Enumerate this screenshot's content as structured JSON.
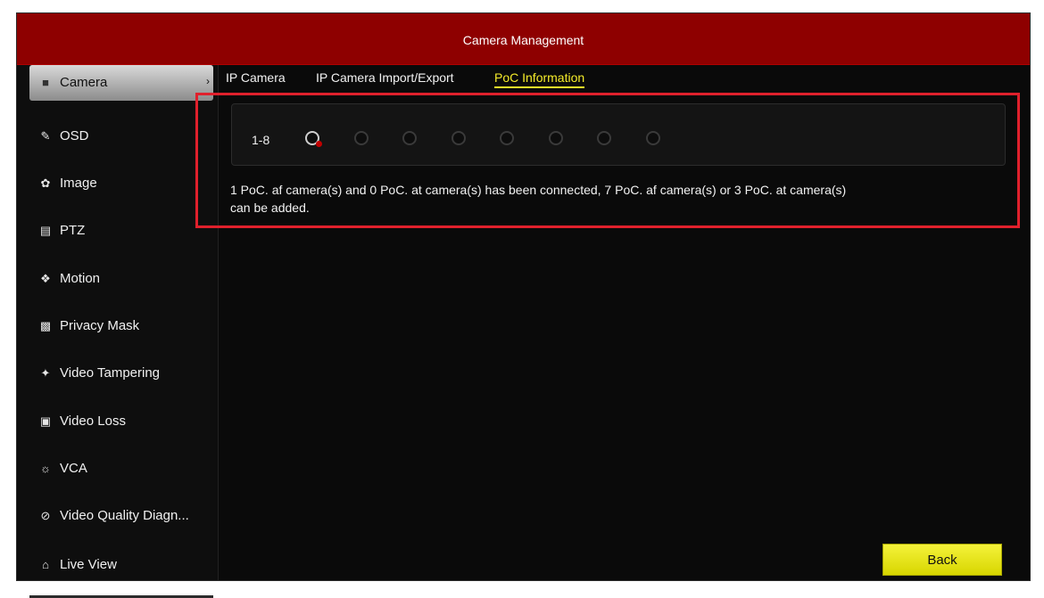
{
  "window": {
    "title": "Camera Management"
  },
  "sidebar": {
    "items": [
      {
        "label": "Camera",
        "icon": "camera-icon",
        "active": true
      },
      {
        "label": "OSD",
        "icon": "pen-icon"
      },
      {
        "label": "Image",
        "icon": "palette-icon"
      },
      {
        "label": "PTZ",
        "icon": "ptz-icon"
      },
      {
        "label": "Motion",
        "icon": "running-man-icon"
      },
      {
        "label": "Privacy Mask",
        "icon": "mask-icon"
      },
      {
        "label": "Video Tampering",
        "icon": "hand-icon"
      },
      {
        "label": "Video Loss",
        "icon": "question-box-icon"
      },
      {
        "label": "VCA",
        "icon": "vca-icon"
      },
      {
        "label": "Video Quality Diagn...",
        "icon": "diagnosis-icon"
      }
    ],
    "live_view": {
      "label": "Live View",
      "icon": "home-icon"
    }
  },
  "tabs": [
    {
      "label": "IP Camera"
    },
    {
      "label": "IP Camera Import/Export"
    },
    {
      "label": "PoC Information",
      "active": true
    }
  ],
  "poc": {
    "channel_range": "1-8",
    "ports": [
      {
        "status": "connected"
      },
      {
        "status": "empty"
      },
      {
        "status": "empty"
      },
      {
        "status": "empty"
      },
      {
        "status": "empty"
      },
      {
        "status": "empty"
      },
      {
        "status": "empty"
      },
      {
        "status": "empty"
      }
    ],
    "info_line1": "1 PoC. af camera(s) and 0 PoC. at camera(s) has been connected, 7 PoC. af camera(s) or 3 PoC. at camera(s)",
    "info_line2": "can be added."
  },
  "buttons": {
    "back": "Back"
  },
  "colors": {
    "titlebar": "#8e0000",
    "active_tab": "#f5ec2a",
    "highlight": "#e0202c",
    "button": "#e8e61a"
  }
}
